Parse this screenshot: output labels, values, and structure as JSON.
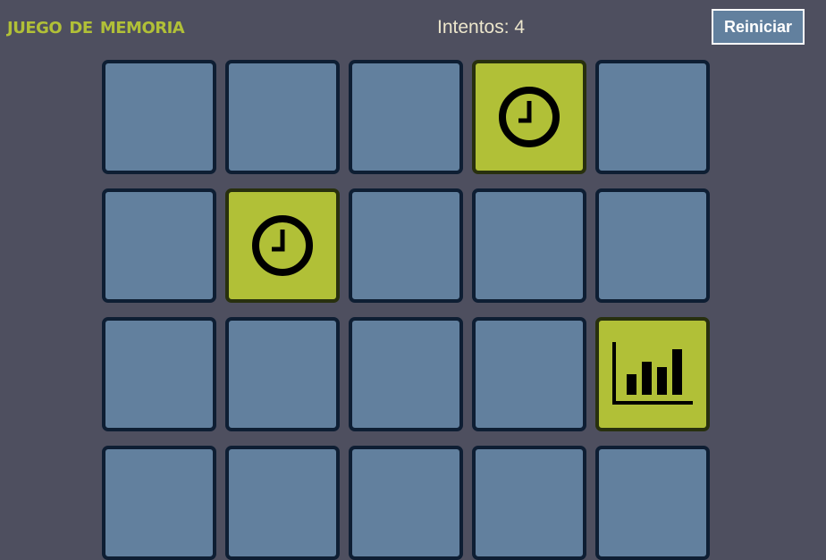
{
  "header": {
    "title": "Juego de Memoria",
    "attempts_label": "Intentos: 4",
    "reset_label": "Reiniciar"
  },
  "colors": {
    "background": "#4e4f5f",
    "title": "#b1c037",
    "card_back": "#62809e",
    "card_front": "#b1c037",
    "card_border": "#0e1e33"
  },
  "board": {
    "columns": 5,
    "cards": [
      {
        "state": "hidden",
        "icon": null
      },
      {
        "state": "hidden",
        "icon": null
      },
      {
        "state": "hidden",
        "icon": null
      },
      {
        "state": "flipped",
        "icon": "clock-icon"
      },
      {
        "state": "hidden",
        "icon": null
      },
      {
        "state": "hidden",
        "icon": null
      },
      {
        "state": "flipped",
        "icon": "clock-icon"
      },
      {
        "state": "hidden",
        "icon": null
      },
      {
        "state": "hidden",
        "icon": null
      },
      {
        "state": "hidden",
        "icon": null
      },
      {
        "state": "hidden",
        "icon": null
      },
      {
        "state": "hidden",
        "icon": null
      },
      {
        "state": "hidden",
        "icon": null
      },
      {
        "state": "hidden",
        "icon": null
      },
      {
        "state": "flipped",
        "icon": "bar-chart-icon"
      },
      {
        "state": "hidden",
        "icon": null
      },
      {
        "state": "hidden",
        "icon": null
      },
      {
        "state": "hidden",
        "icon": null
      },
      {
        "state": "hidden",
        "icon": null
      },
      {
        "state": "hidden",
        "icon": null
      }
    ]
  }
}
